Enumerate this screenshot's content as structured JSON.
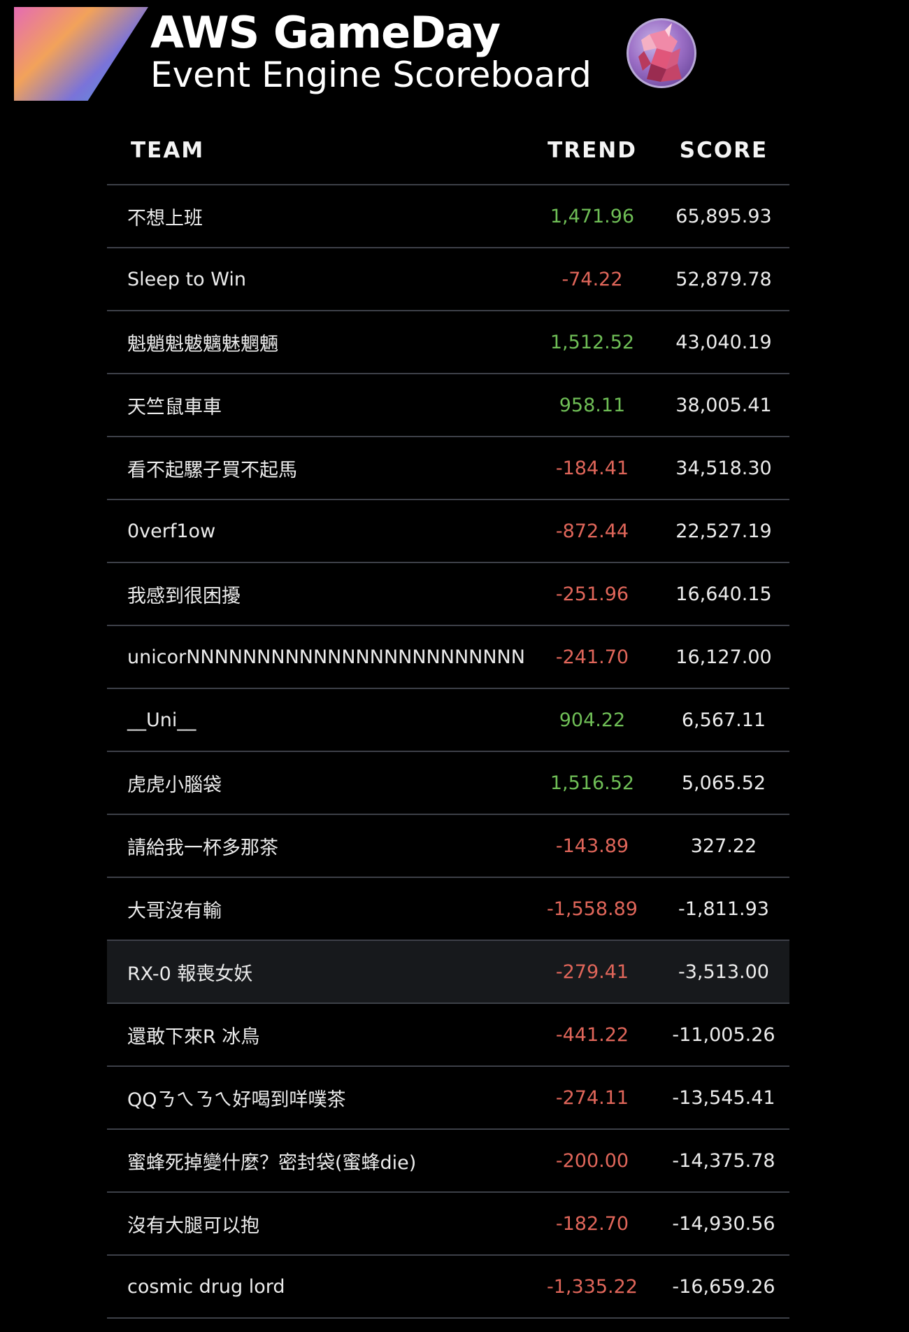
{
  "header": {
    "title": "AWS GameDay",
    "subtitle": "Event Engine Scoreboard"
  },
  "table": {
    "columns": {
      "team": "TEAM",
      "trend": "TREND",
      "score": "SCORE"
    },
    "rows": [
      {
        "team": "不想上班",
        "trend": "1,471.96",
        "score": "65,895.93",
        "trend_dir": "pos"
      },
      {
        "team": "Sleep to Win",
        "trend": "-74.22",
        "score": "52,879.78",
        "trend_dir": "neg"
      },
      {
        "team": "魁魈魁魃魑魅魍魎",
        "trend": "1,512.52",
        "score": "43,040.19",
        "trend_dir": "pos"
      },
      {
        "team": "天竺鼠車車",
        "trend": "958.11",
        "score": "38,005.41",
        "trend_dir": "pos"
      },
      {
        "team": "看不起騾子買不起馬",
        "trend": "-184.41",
        "score": "34,518.30",
        "trend_dir": "neg"
      },
      {
        "team": "0verf1ow",
        "trend": "-872.44",
        "score": "22,527.19",
        "trend_dir": "neg"
      },
      {
        "team": "我感到很困擾",
        "trend": "-251.96",
        "score": "16,640.15",
        "trend_dir": "neg"
      },
      {
        "team": "unicorNNNNNNNNNNNNNNNNNNNNNNNN",
        "trend": "-241.70",
        "score": "16,127.00",
        "trend_dir": "neg"
      },
      {
        "team": "__Uni__",
        "trend": "904.22",
        "score": "6,567.11",
        "trend_dir": "pos"
      },
      {
        "team": "虎虎小腦袋",
        "trend": "1,516.52",
        "score": "5,065.52",
        "trend_dir": "pos"
      },
      {
        "team": "請給我一杯多那茶",
        "trend": "-143.89",
        "score": "327.22",
        "trend_dir": "neg"
      },
      {
        "team": "大哥沒有輸",
        "trend": "-1,558.89",
        "score": "-1,811.93",
        "trend_dir": "neg"
      },
      {
        "team": "RX-0 報喪女妖",
        "trend": "-279.41",
        "score": "-3,513.00",
        "trend_dir": "neg"
      },
      {
        "team": "還敢下來R 冰鳥",
        "trend": "-441.22",
        "score": "-11,005.26",
        "trend_dir": "neg"
      },
      {
        "team": "QQㄋㄟㄋㄟ好喝到咩噗茶",
        "trend": "-274.11",
        "score": "-13,545.41",
        "trend_dir": "neg"
      },
      {
        "team": "蜜蜂死掉變什麼？密封袋(蜜蜂die)",
        "trend": "-200.00",
        "score": "-14,375.78",
        "trend_dir": "neg"
      },
      {
        "team": "沒有大腿可以抱",
        "trend": "-182.70",
        "score": "-14,930.56",
        "trend_dir": "neg"
      },
      {
        "team": "cosmic drug lord",
        "trend": "-1,335.22",
        "score": "-16,659.26",
        "trend_dir": "neg"
      }
    ]
  },
  "colors": {
    "background": "#000000",
    "trend_positive": "#6fbe56",
    "trend_negative": "#e0665a",
    "row_divider": "#3d4048",
    "highlight_row": "#17191c"
  },
  "icons": {
    "logo": "gradient-triangle-logo",
    "avatar": "unicorn-avatar-icon"
  }
}
